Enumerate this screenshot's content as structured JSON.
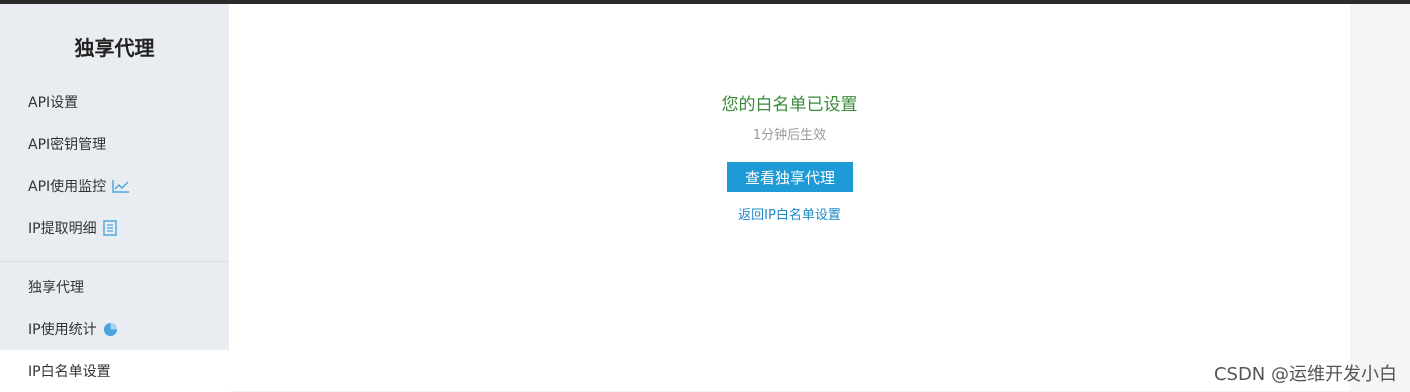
{
  "sidebar": {
    "title": "独享代理",
    "items": [
      {
        "label": "API设置",
        "icon": null
      },
      {
        "label": "API密钥管理",
        "icon": null
      },
      {
        "label": "API使用监控",
        "icon": "line-chart-icon"
      },
      {
        "label": "IP提取明细",
        "icon": "document-icon"
      },
      {
        "label": "独享代理",
        "icon": null
      },
      {
        "label": "IP使用统计",
        "icon": "pie-chart-icon"
      },
      {
        "label": "IP白名单设置",
        "icon": null,
        "active": true
      }
    ]
  },
  "main": {
    "title": "您的白名单已设置",
    "subtitle": "1分钟后生效",
    "primary_button": "查看独享代理",
    "back_link": "返回IP白名单设置"
  },
  "watermark": "CSDN @运维开发小白",
  "colors": {
    "accent": "#1e9ad6",
    "success": "#3a8a3a",
    "sidebar_bg": "#e9edf2",
    "icon_blue": "#4aa3df"
  }
}
